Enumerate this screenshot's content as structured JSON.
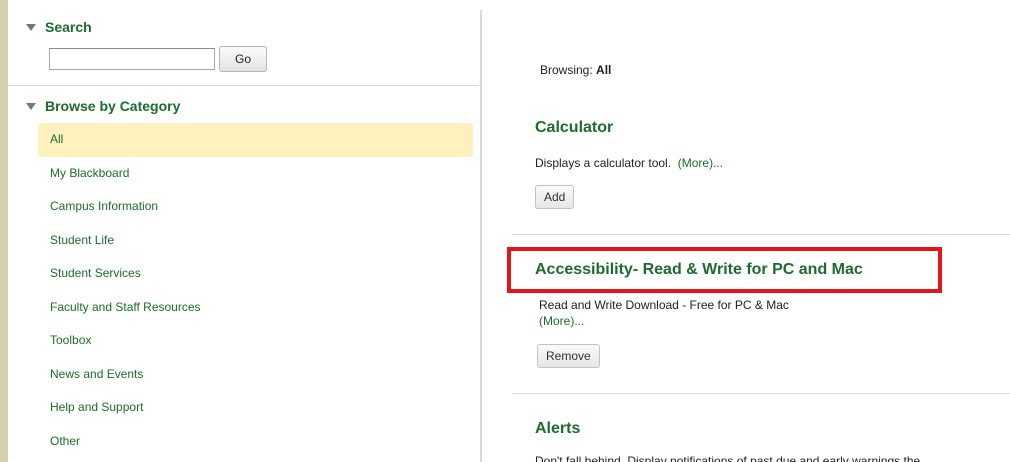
{
  "sidebar": {
    "search": {
      "title": "Search",
      "input_value": "",
      "go_label": "Go"
    },
    "browse": {
      "title": "Browse by Category",
      "selected_index": 0,
      "items": [
        "All",
        "My Blackboard",
        "Campus Information",
        "Student Life",
        "Student Services",
        "Faculty and Staff Resources",
        "Toolbox",
        "News and Events",
        "Help and Support",
        "Other"
      ]
    }
  },
  "main": {
    "browsing_label": "Browsing:",
    "browsing_value": "All",
    "tools": [
      {
        "title": "Calculator",
        "description": "Displays a calculator tool.",
        "more": "(More)...",
        "button": "Add"
      },
      {
        "title": "Accessibility- Read & Write for PC and Mac",
        "description": "Read and Write Download - Free for PC & Mac",
        "more": "(More)...",
        "button": "Remove"
      },
      {
        "title": "Alerts",
        "description": "Don't fall behind. Display notifications of past due and early warnings the"
      }
    ]
  },
  "colors": {
    "accent_green": "#1d6b2e",
    "selected_bg": "#fdf2be",
    "highlight_red": "#e4141b",
    "left_strip": "#d3d0ad"
  }
}
